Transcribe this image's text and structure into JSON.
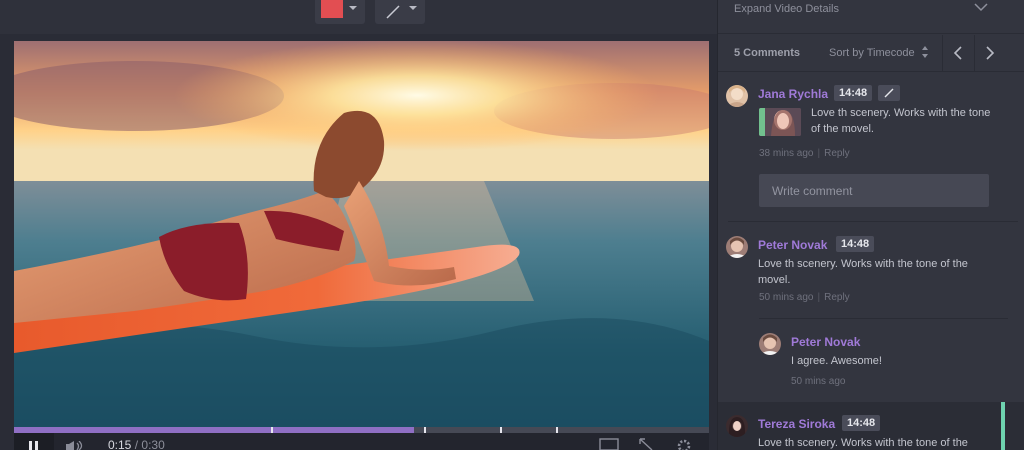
{
  "toolbar": {
    "color_swatch": "#e24e52",
    "color_picker_icon": "color-swatch-icon",
    "line_tool_icon": "line-tool-icon"
  },
  "player": {
    "current_time": "0:15",
    "separator": "/",
    "duration": "0:30",
    "progress": 0.5,
    "comment_markers": [
      0.37,
      0.59,
      0.7,
      0.78
    ],
    "play_state_icon": "pause-icon",
    "volume_icon": "volume-icon",
    "fullscreen_icon": "fullscreen-icon",
    "expand_icon": "expand-icon",
    "settings_icon": "gear-icon"
  },
  "panel": {
    "details_label": "Expand Video Details",
    "comments_count": "5 Comments",
    "sort_label": "Sort by Timecode",
    "prev_icon": "chevron-left-icon",
    "next_icon": "chevron-right-icon",
    "write_placeholder": "Write comment",
    "comments": [
      {
        "author": "Jana Rychla",
        "timecode": "14:48",
        "has_drawing": true,
        "text": "Love th scenery. Works with the tone of the movel.",
        "time_ago": "38 mins ago",
        "reply": "Reply"
      },
      {
        "author": "Peter Novak",
        "timecode": "14:48",
        "text": "Love th scenery. Works with the tone of the movel.",
        "time_ago": "50 mins ago",
        "reply": "Reply"
      },
      {
        "author": "Peter Novak",
        "text": "I agree. Awesome!",
        "time_ago": "50 mins ago",
        "is_reply": true
      },
      {
        "author": "Tereza Siroka",
        "timecode": "14:48",
        "text": "Love th scenery. Works with the tone of the"
      }
    ]
  },
  "colors": {
    "accent_purple": "#a07ad8",
    "active_green": "#6fd3b0",
    "panel_bg": "#33353f"
  }
}
